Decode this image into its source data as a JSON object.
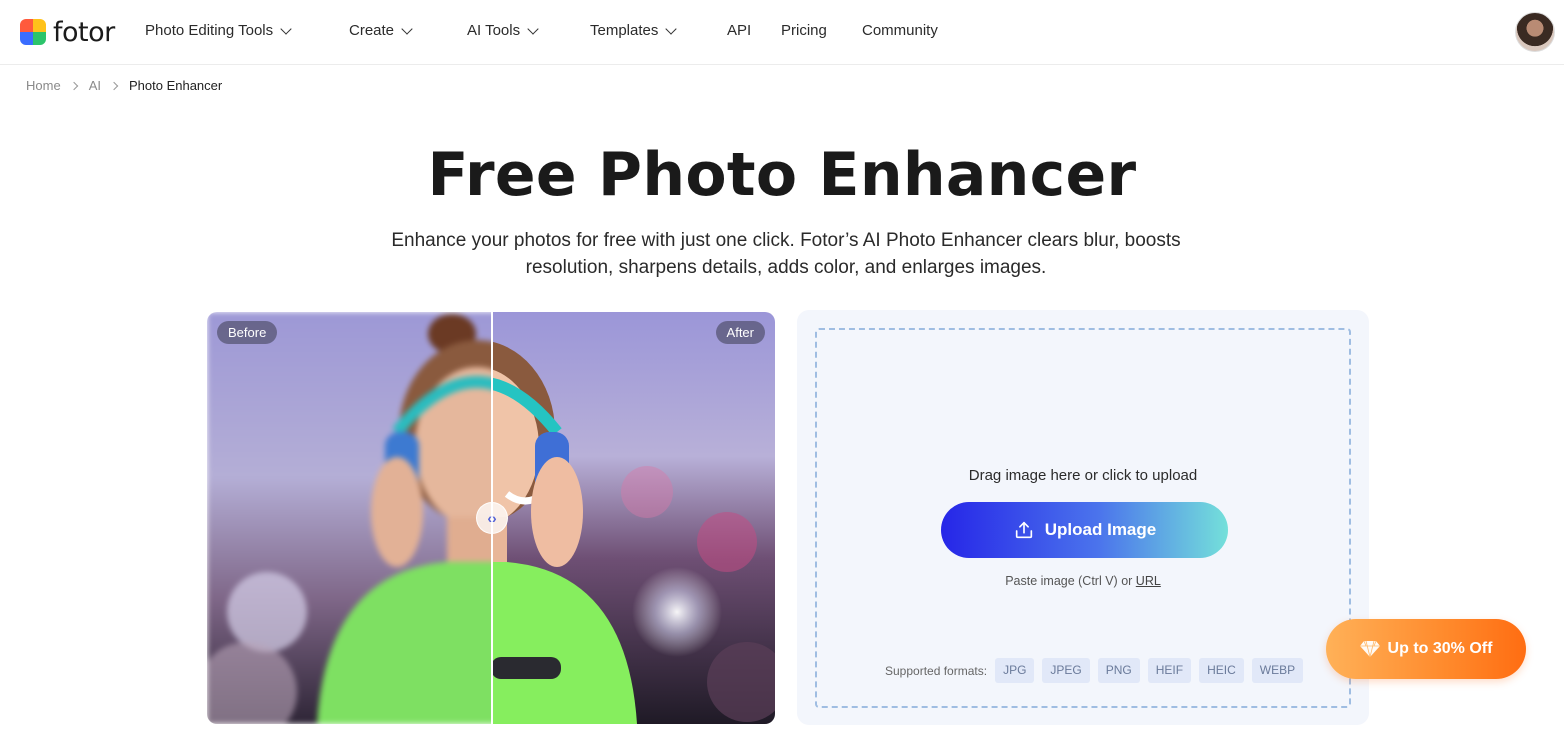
{
  "brand": {
    "name": "fotor"
  },
  "nav": {
    "items": [
      {
        "label": "Photo Editing Tools",
        "has_dropdown": true
      },
      {
        "label": "Create",
        "has_dropdown": true
      },
      {
        "label": "AI Tools",
        "has_dropdown": true
      },
      {
        "label": "Templates",
        "has_dropdown": true
      },
      {
        "label": "API",
        "has_dropdown": false
      },
      {
        "label": "Pricing",
        "has_dropdown": false
      },
      {
        "label": "Community",
        "has_dropdown": false
      }
    ]
  },
  "breadcrumb": {
    "items": [
      "Home",
      "AI",
      "Photo Enhancer"
    ]
  },
  "hero": {
    "title": "Free Photo Enhancer",
    "subtitle_line1": "Enhance your photos for free with just one click. Fotor’s AI Photo Enhancer clears blur, boosts",
    "subtitle_line2": "resolution, sharpens details, adds color, and enlarges images."
  },
  "compare": {
    "before_label": "Before",
    "after_label": "After"
  },
  "upload": {
    "drag_text": "Drag image here or click to upload",
    "button_label": "Upload Image",
    "paste_text": "Paste image (Ctrl V) or",
    "url_label": "URL",
    "formats_label": "Supported formats:",
    "formats": [
      "JPG",
      "JPEG",
      "PNG",
      "HEIF",
      "HEIC",
      "WEBP"
    ]
  },
  "promo": {
    "label": "Up to 30% Off"
  },
  "colors": {
    "upload_gradient_start": "#2626e8",
    "upload_gradient_end": "#74e0da",
    "promo_orange": "#ff8a2c",
    "panel_bg": "#f3f6fc",
    "dropzone_border": "#9fbde2"
  },
  "icons": {
    "upload": "upload-arrow-icon",
    "promo": "diamond-icon",
    "handle": "left-right-arrows-icon"
  }
}
